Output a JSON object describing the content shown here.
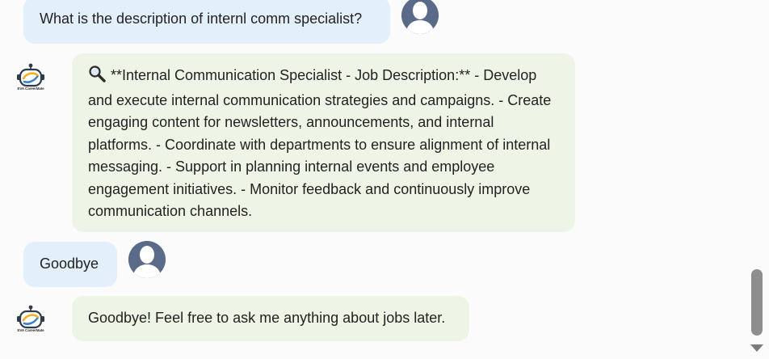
{
  "messages": [
    {
      "role": "user",
      "text": "What is the description of internl comm specialist?"
    },
    {
      "role": "bot",
      "icon": "magnifying-glass-icon",
      "text": "**Internal Communication Specialist - Job Description:** - Develop and execute internal communication strategies and campaigns. - Create engaging content for newsletters, announcements, and internal platforms. - Coordinate with departments to ensure alignment of internal messaging. - Support in planning internal events and employee engagement initiatives. - Monitor feedback and continuously improve communication channels."
    },
    {
      "role": "user",
      "text": "Goodbye"
    },
    {
      "role": "bot",
      "text": "Goodbye! Feel free to ask me anything about jobs later."
    }
  ],
  "bot": {
    "logo_text": "EVA CareerMate"
  },
  "colors": {
    "user_bubble": "#e3f0fc",
    "bot_bubble": "#eff5e6",
    "user_avatar": "#5a6b8a",
    "background": "#fbfbfb"
  }
}
